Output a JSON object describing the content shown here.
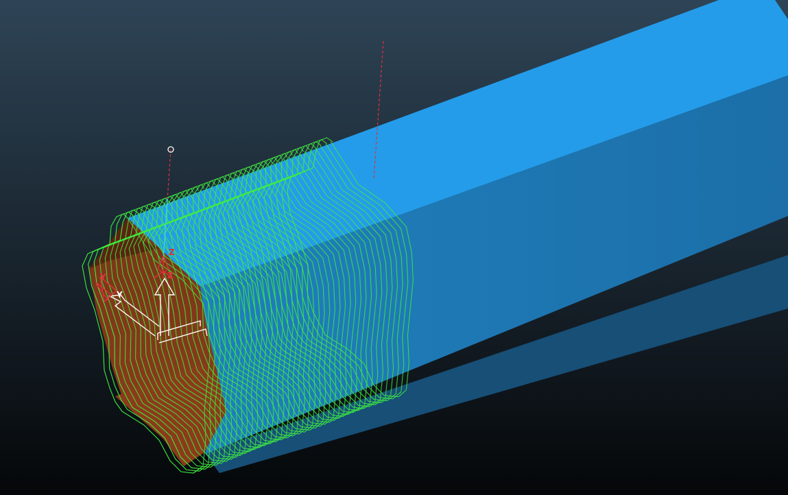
{
  "viewport": {
    "background_top": "#2e4456",
    "background_bottom": "#050709"
  },
  "model": {
    "stock_colors": {
      "top_face": "#249cea",
      "side_face": "#1f7fbd",
      "bottom_face": "#1a5e8c",
      "cut_face_light": "#8a3a1c",
      "cut_face_dark": "#6e2b12"
    },
    "toolpath_color": "#3fef3f",
    "guide_line_color": "#e0303c",
    "tool_axis_color": "#34d6e8"
  },
  "triads": {
    "tool_triad": {
      "z_label": "Z",
      "color": "#e0303c"
    },
    "workplane_triad": {
      "y_label": "Y",
      "z_label": "Z",
      "color": "#e0303c"
    },
    "world_triad": {
      "color": "#ffffff"
    }
  }
}
